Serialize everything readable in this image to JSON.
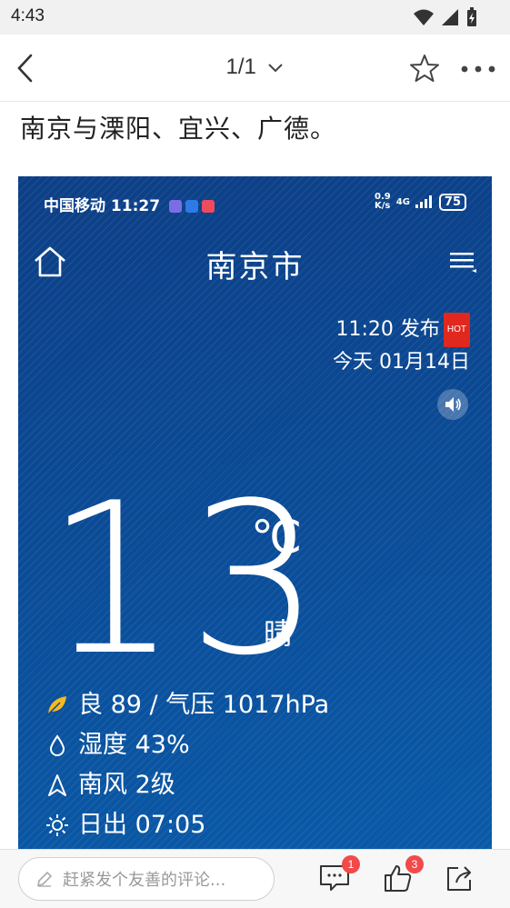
{
  "status_bar": {
    "time": "4:43"
  },
  "nav": {
    "page_indicator": "1/1"
  },
  "article": {
    "text": "南京与溧阳、宜兴、广德。"
  },
  "screenshot": {
    "carrier_time": "中国移动 11:27",
    "net_speed": "0.9\nK/s",
    "net_type": "4G",
    "battery": "75",
    "city": "南京市",
    "publish_time": "11:20 发布",
    "hot_badge": "HOT",
    "date": "今天 01月14日",
    "temperature": "13",
    "temp_unit": "℃",
    "condition": "晴",
    "air_quality": "良 89 / 气压 1017hPa",
    "humidity": "湿度 43%",
    "wind": "南风 2级",
    "sunrise": "日出  07:05",
    "colors": {
      "bg_top": "#0d3f86",
      "bg_bottom": "#0a5aa8",
      "leaf": "#f5b921",
      "hot": "#e0281e"
    }
  },
  "bottom_bar": {
    "comment_placeholder": "赶紧发个友善的评论...",
    "comment_count": "1",
    "like_count": "3"
  }
}
